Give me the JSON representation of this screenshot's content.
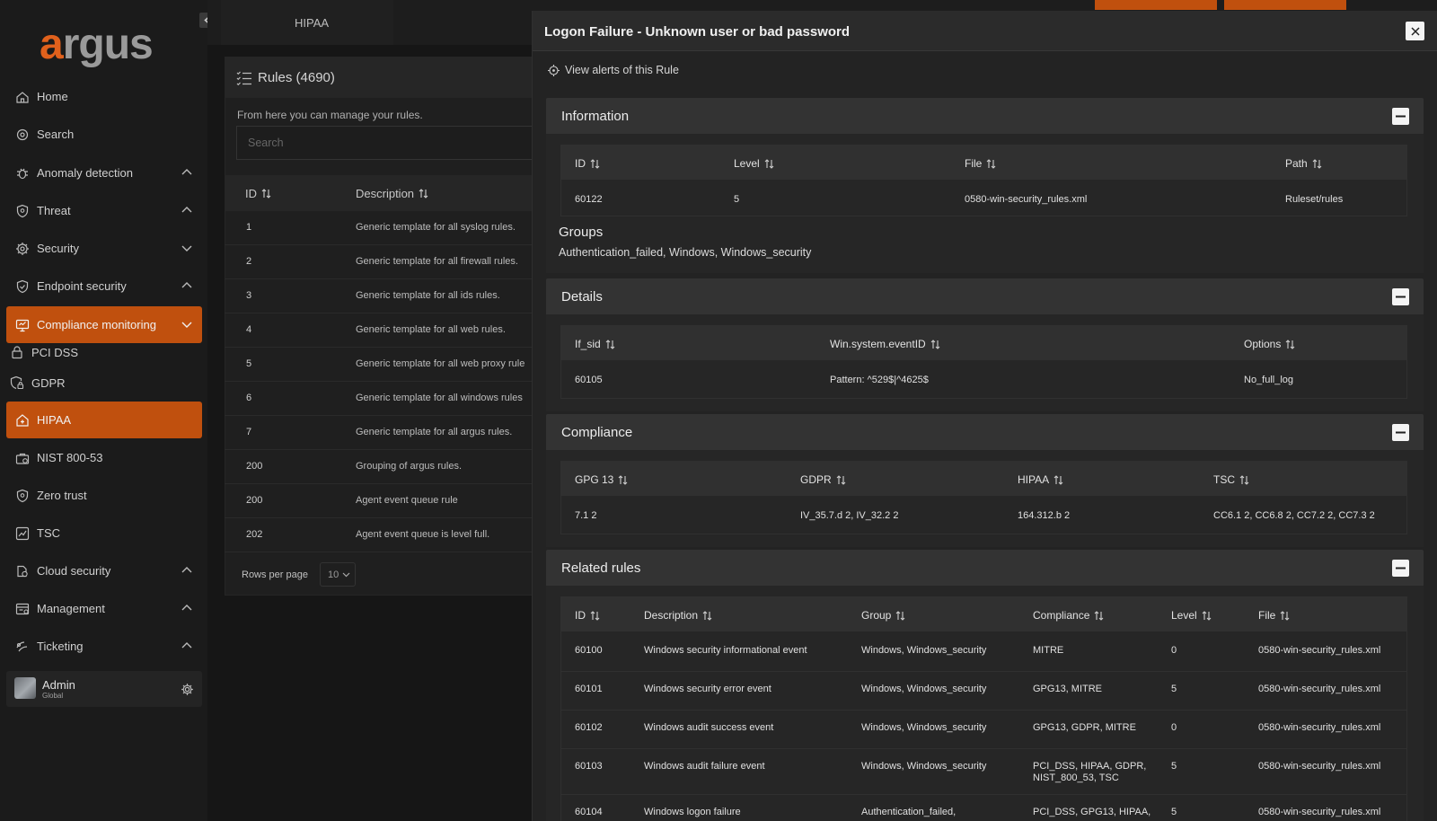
{
  "sidebar": {
    "logo": {
      "first": "a",
      "rest": "rgus"
    },
    "items": [
      {
        "label": "Home",
        "icon": "home-icon"
      },
      {
        "label": "Search",
        "icon": "search-icon"
      },
      {
        "label": "Anomaly detection",
        "icon": "bug-icon"
      },
      {
        "label": "Threat",
        "icon": "shield-icon"
      },
      {
        "label": "Security",
        "icon": "gear-icon"
      },
      {
        "label": "Endpoint security",
        "icon": "shield-check-icon"
      },
      {
        "label": "Compliance monitoring",
        "icon": "monitor-icon"
      },
      {
        "label": "PCI DSS",
        "icon": "lock-icon"
      },
      {
        "label": "GDPR",
        "icon": "shield-lock-icon"
      },
      {
        "label": "HIPAA",
        "icon": "medical-icon"
      },
      {
        "label": "NIST 800-53",
        "icon": "briefcase-icon"
      },
      {
        "label": "Zero trust",
        "icon": "shield-icon"
      },
      {
        "label": "TSC",
        "icon": "chart-icon"
      },
      {
        "label": "Cloud security",
        "icon": "cloud-icon"
      },
      {
        "label": "Management",
        "icon": "folder-icon"
      },
      {
        "label": "Ticketing",
        "icon": "ticket-icon"
      }
    ],
    "user": {
      "name": "Admin",
      "role": "Global"
    }
  },
  "topbar": {
    "tab": "HIPAA"
  },
  "rules": {
    "title": "Rules (4690)",
    "subtitle": "From here you can manage your rules.",
    "search_placeholder": "Search",
    "columns": [
      "ID",
      "Description"
    ],
    "rows": [
      [
        "1",
        "Generic template for all syslog rules."
      ],
      [
        "2",
        "Generic template for all firewall rules."
      ],
      [
        "3",
        "Generic template for all ids rules."
      ],
      [
        "4",
        "Generic template for all web rules."
      ],
      [
        "5",
        "Generic template for all web proxy rule"
      ],
      [
        "6",
        "Generic template for all windows rules"
      ],
      [
        "7",
        "Generic template for all argus rules."
      ],
      [
        "200",
        "Grouping of argus rules."
      ],
      [
        "200",
        "Agent event queue rule"
      ],
      [
        "202",
        "Agent event queue is level full."
      ]
    ],
    "rows_per_page_label": "Rows per page",
    "rows_per_page": "10"
  },
  "flyout": {
    "title": "Logon Failure - Unknown user or bad password",
    "view_alerts": "View alerts of this Rule",
    "information": {
      "title": "Information",
      "columns": [
        "ID",
        "Level",
        "File",
        "Path"
      ],
      "row": [
        "60122",
        "5",
        "0580-win-security_rules.xml",
        "Ruleset/rules"
      ],
      "groups_title": "Groups",
      "groups": "Authentication_failed, Windows, Windows_security"
    },
    "details": {
      "title": "Details",
      "columns": [
        "If_sid",
        "Win.system.eventID",
        "Options"
      ],
      "row": [
        "60105",
        "Pattern: ^529$|^4625$",
        "No_full_log"
      ]
    },
    "compliance": {
      "title": "Compliance",
      "columns": [
        "GPG 13",
        "GDPR",
        "HIPAA",
        "TSC"
      ],
      "row": [
        "7.1 2",
        "IV_35.7.d 2, IV_32.2 2",
        "164.312.b 2",
        "CC6.1 2, CC6.8 2, CC7.2 2, CC7.3 2"
      ]
    },
    "related": {
      "title": "Related rules",
      "columns": [
        "ID",
        "Description",
        "Group",
        "Compliance",
        "Level",
        "File"
      ],
      "rows": [
        [
          "60100",
          "Windows security informational event",
          "Windows, Windows_security",
          "MITRE",
          "0",
          "0580-win-security_rules.xml"
        ],
        [
          "60101",
          "Windows security error event",
          "Windows, Windows_security",
          "GPG13, MITRE",
          "5",
          "0580-win-security_rules.xml"
        ],
        [
          "60102",
          "Windows audit success event",
          "Windows, Windows_security",
          "GPG13, GDPR, MITRE",
          "0",
          "0580-win-security_rules.xml"
        ],
        [
          "60103",
          "Windows audit failure event",
          "Windows, Windows_security",
          "PCI_DSS, HIPAA, GDPR,\nNIST_800_53, TSC",
          "5",
          "0580-win-security_rules.xml"
        ],
        [
          "60104",
          "Windows logon failure",
          "Authentication_failed,",
          "PCI_DSS, GPG13, HIPAA,",
          "5",
          "0580-win-security_rules.xml"
        ]
      ]
    }
  },
  "colors": {
    "accent": "#c0500e",
    "background": "#161616",
    "panel": "#232323"
  }
}
